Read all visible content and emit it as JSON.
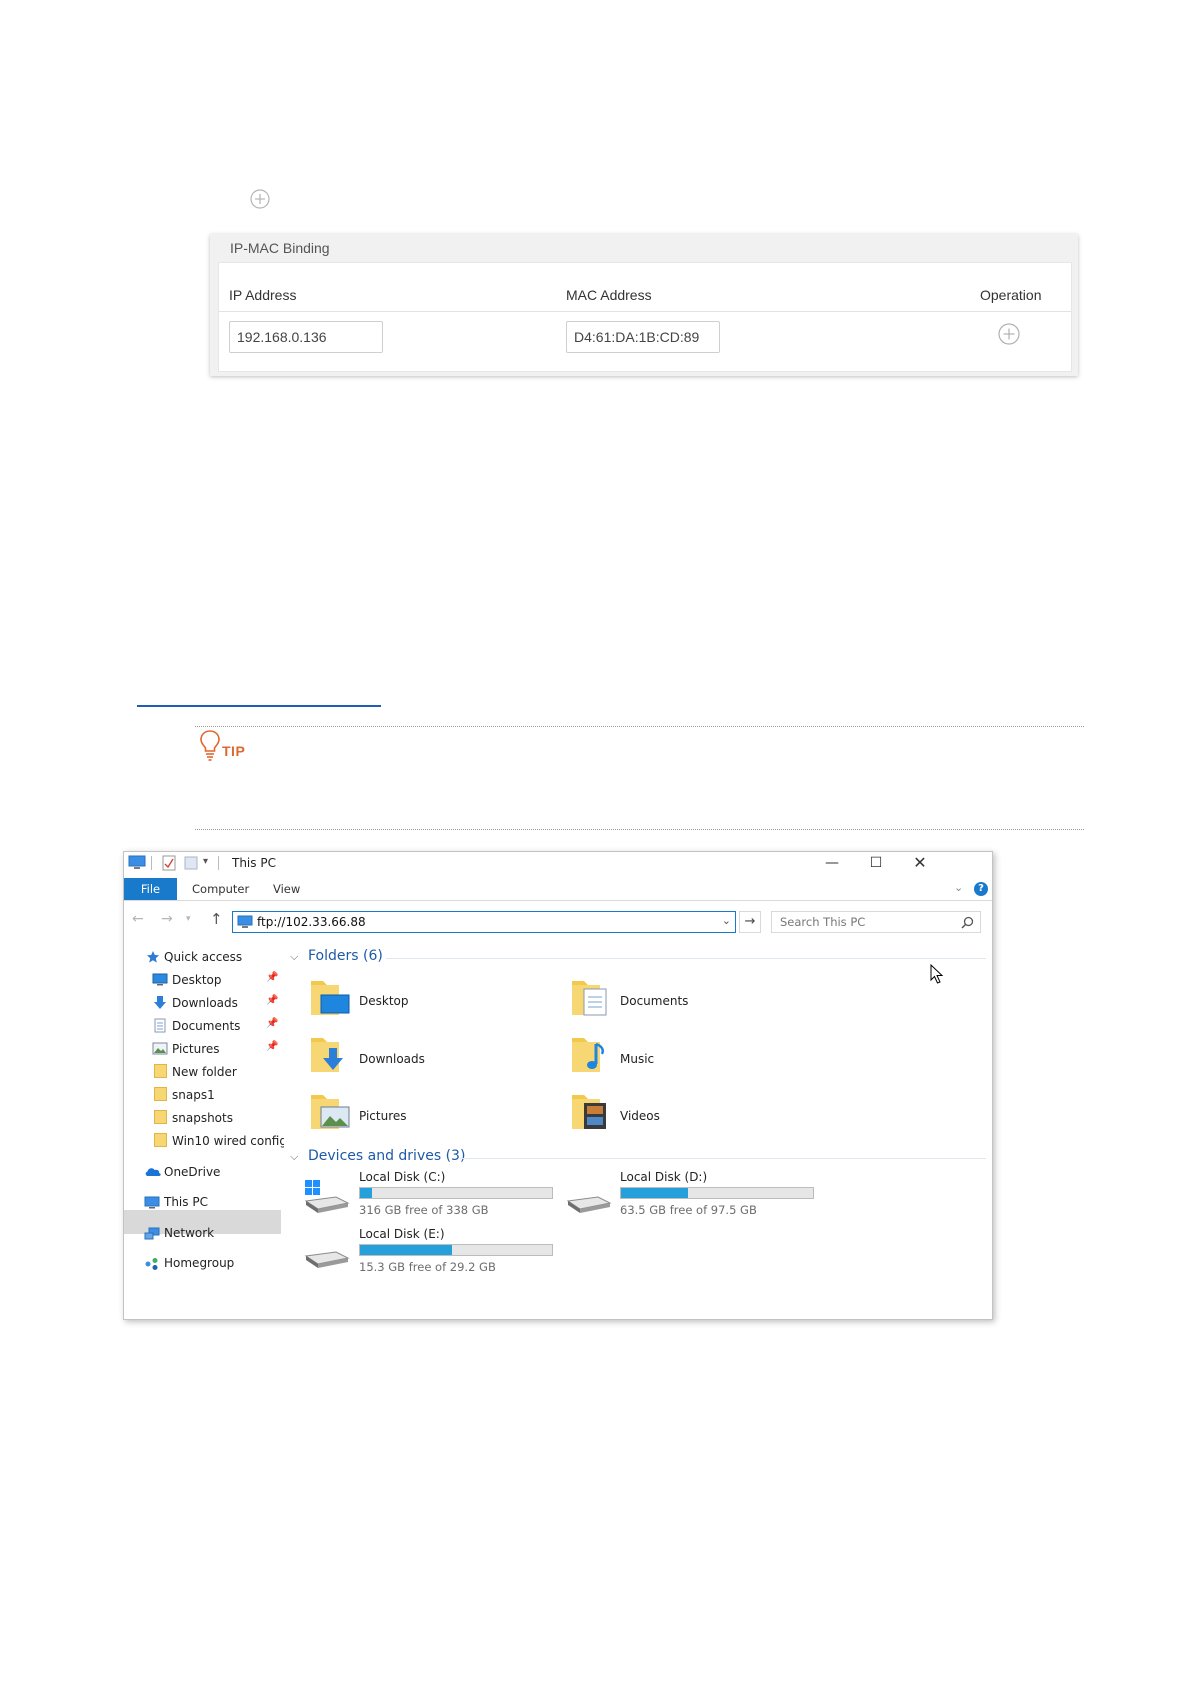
{
  "ipmac": {
    "title": "IP-MAC Binding",
    "columns": {
      "ip": "IP Address",
      "mac": "MAC Address",
      "operation": "Operation"
    },
    "row": {
      "ip": "192.168.0.136",
      "mac": "D4:61:DA:1B:CD:89"
    }
  },
  "tip": {
    "label": "TIP",
    "accent": "#e0672f"
  },
  "explorer": {
    "title": "This PC",
    "ribbon": {
      "file": "File",
      "computer": "Computer",
      "view": "View"
    },
    "address": "ftp://102.33.66.88",
    "search_placeholder": "Search This PC",
    "nav": {
      "quick_access": "Quick access",
      "desktop": "Desktop",
      "downloads": "Downloads",
      "documents": "Documents",
      "pictures": "Pictures",
      "new_folder": "New folder",
      "snaps1": "snaps1",
      "snapshots": "snapshots",
      "win10": "Win10 wired config",
      "onedrive": "OneDrive",
      "this_pc": "This PC",
      "network": "Network",
      "homegroup": "Homegroup"
    },
    "folders_header": "Folders (6)",
    "folders": {
      "desktop": "Desktop",
      "documents": "Documents",
      "downloads": "Downloads",
      "music": "Music",
      "pictures": "Pictures",
      "videos": "Videos"
    },
    "drives_header": "Devices and drives (3)",
    "drives": {
      "c": {
        "name": "Local Disk (C:)",
        "free": "316 GB free of 338 GB",
        "used_fraction": 0.065
      },
      "d": {
        "name": "Local Disk (D:)",
        "free": "63.5 GB free of 97.5 GB",
        "used_fraction": 0.35
      },
      "e": {
        "name": "Local Disk (E:)",
        "free": "15.3 GB free of 29.2 GB",
        "used_fraction": 0.48
      }
    },
    "accent": "#1979ca"
  }
}
